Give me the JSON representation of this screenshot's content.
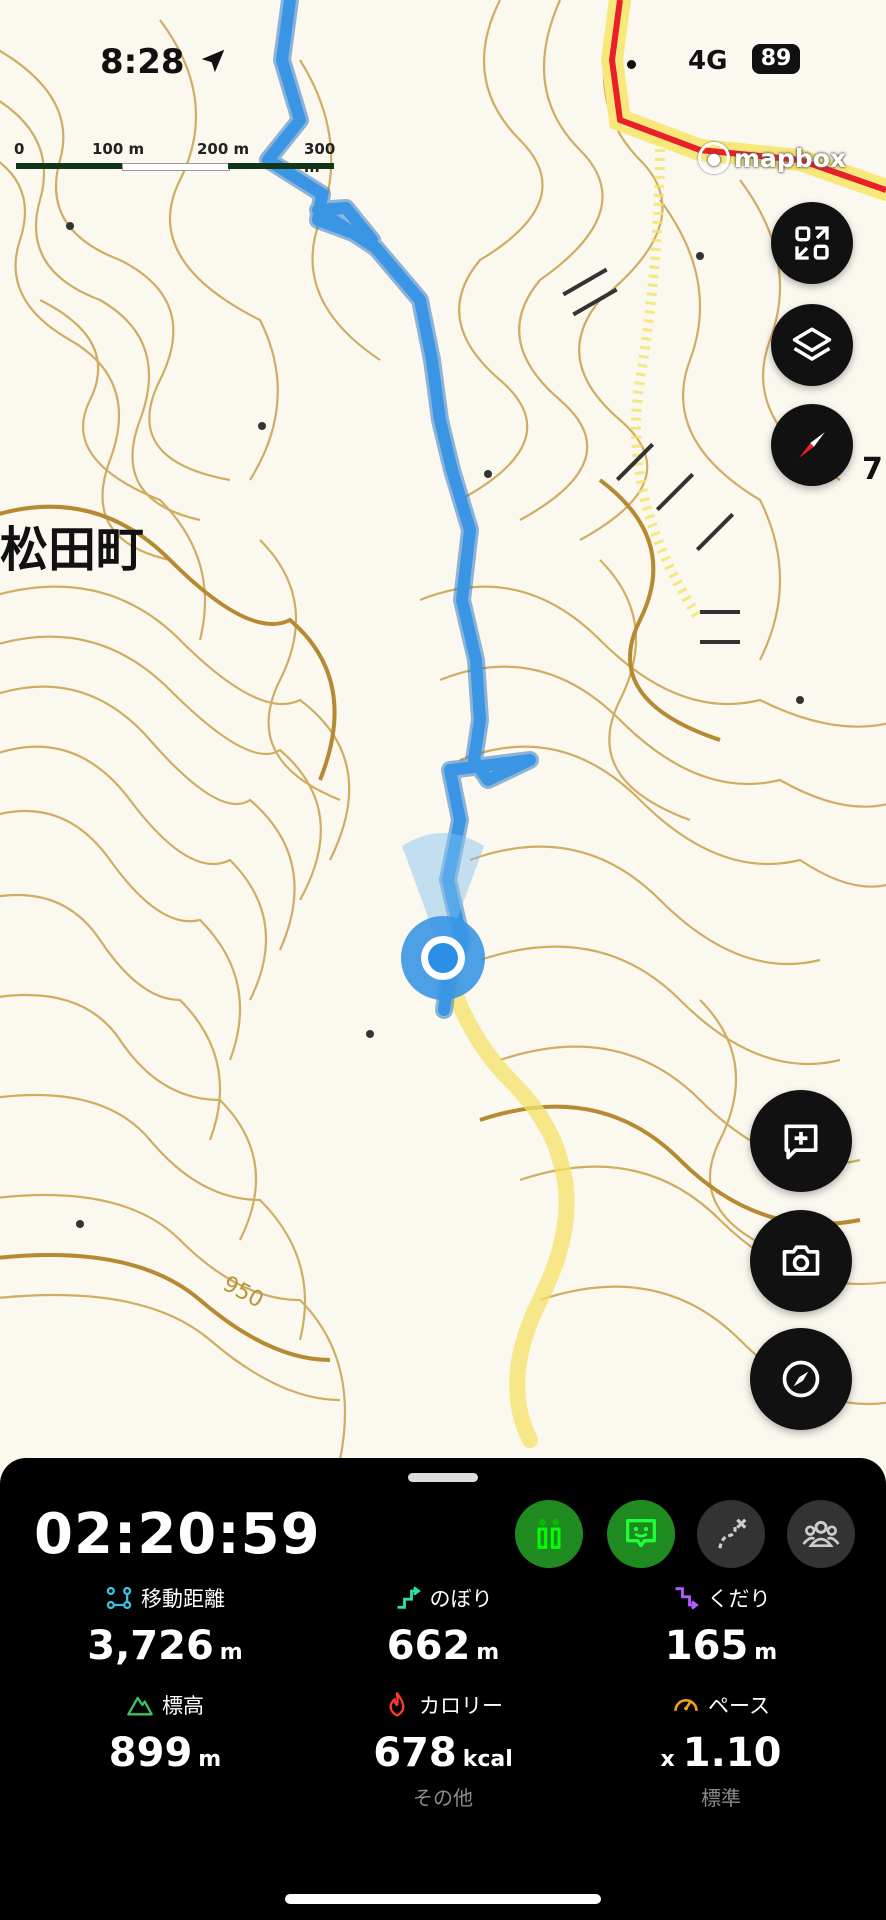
{
  "status_bar": {
    "time": "8:28",
    "network": "4G",
    "battery": "89"
  },
  "map": {
    "scale_labels": [
      "0",
      "100 m",
      "200 m",
      "300 m"
    ],
    "attribution": "mapbox",
    "place_label": "松田町",
    "edge_label": "7",
    "contour_label": "950",
    "colors": {
      "track": "#2f8fe0",
      "trail": "#f4e267",
      "road": "#e8202a",
      "contour": "#c49a3f"
    }
  },
  "map_buttons": [
    "fullscreen-icon",
    "layers-icon",
    "compass-icon",
    "add-memo-icon",
    "camera-icon",
    "navigation-icon"
  ],
  "panel": {
    "timer": "02:20:59",
    "stats": {
      "distance": {
        "label": "移動距離",
        "value": "3,726",
        "unit": "m"
      },
      "ascent": {
        "label": "のぼり",
        "value": "662",
        "unit": "m"
      },
      "descent": {
        "label": "くだり",
        "value": "165",
        "unit": "m"
      },
      "altitude": {
        "label": "標高",
        "value": "899",
        "unit": "m"
      },
      "calories": {
        "label": "カロリー",
        "value": "678",
        "unit": "kcal",
        "sub": "その他"
      },
      "pace": {
        "label": "ペース",
        "prefix": "x",
        "value": "1.10",
        "sub": "標準"
      }
    }
  }
}
